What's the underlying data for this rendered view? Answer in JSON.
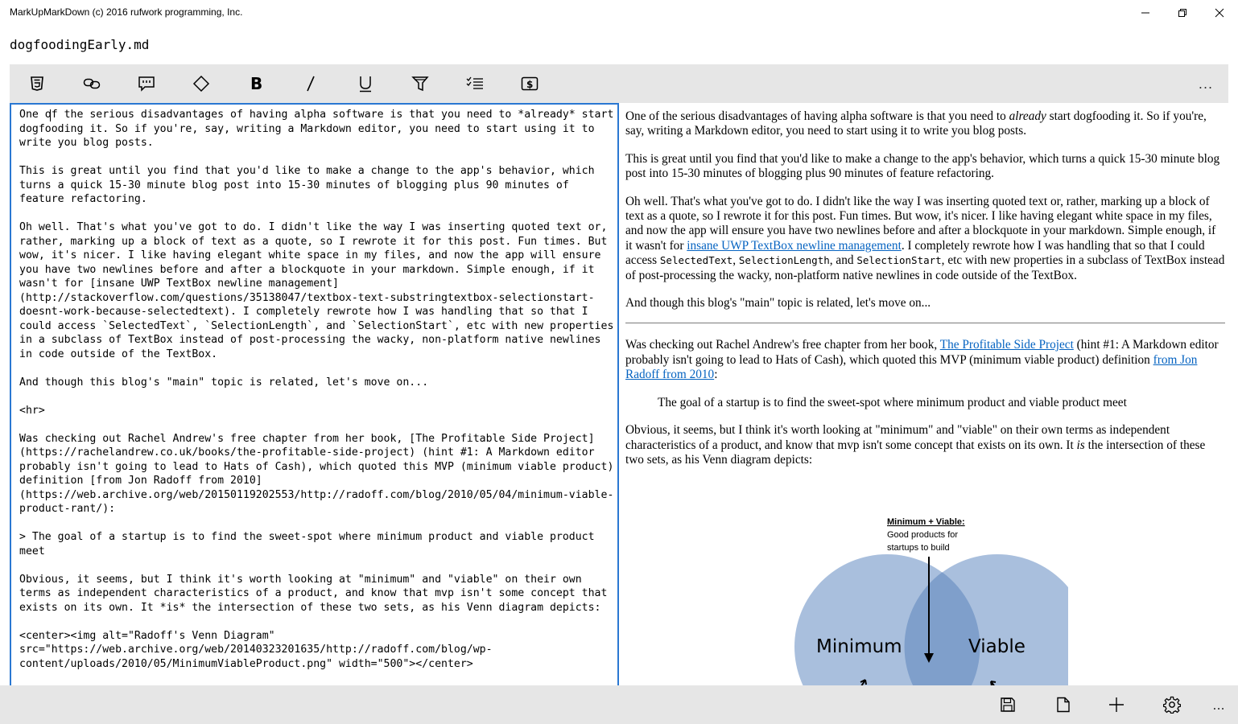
{
  "window": {
    "title": "MarkUpMarkDown (c) 2016 rufwork programming, Inc.",
    "controls": [
      "minimize-icon",
      "restore-icon",
      "close-icon"
    ]
  },
  "file": {
    "name": "dogfoodingEarly.md"
  },
  "toolbar": {
    "buttons": [
      "html5-icon",
      "link-icon",
      "comment-icon",
      "diamond-icon",
      "bold-icon",
      "italic-icon",
      "underline-icon",
      "highlight-icon",
      "checklist-icon",
      "dollar-icon"
    ],
    "more": "..."
  },
  "editor": {
    "text": "One of the serious disadvantages of having alpha software is that you need to *already* start dogfooding it. So if you're, say, writing a Markdown editor, you need to start using it to write you blog posts.\n\nThis is great until you find that you'd like to make a change to the app's behavior, which turns a quick 15-30 minute blog post into 15-30 minutes of blogging plus 90 minutes of feature refactoring.\n\nOh well. That's what you've got to do. I didn't like the way I was inserting quoted text or, rather, marking up a block of text as a quote, so I rewrote it for this post. Fun times. But wow, it's nicer. I like having elegant white space in my files, and now the app will ensure you have two newlines before and after a blockquote in your markdown. Simple enough, if it wasn't for [insane UWP TextBox newline management](http://stackoverflow.com/questions/35138047/textbox-text-substringtextbox-selectionstart-doesnt-work-because-selectedtext). I completely rewrote how I was handling that so that I could access `SelectedText`, `SelectionLength`, and `SelectionStart`, etc with new properties in a subclass of TextBox instead of post-processing the wacky, non-platform native newlines in code outside of the TextBox.\n\nAnd though this blog's \"main\" topic is related, let's move on...\n\n<hr>\n\nWas checking out Rachel Andrew's free chapter from her book, [The Profitable Side Project](https://rachelandrew.co.uk/books/the-profitable-side-project) (hint #1: A Markdown editor probably isn't going to lead to Hats of Cash), which quoted this MVP (minimum viable product) definition [from Jon Radoff from 2010](https://web.archive.org/web/20150119202553/http://radoff.com/blog/2010/05/04/minimum-viable-product-rant/):\n\n> The goal of a startup is to find the sweet-spot where minimum product and viable product meet\n\nObvious, it seems, but I think it's worth looking at \"minimum\" and \"viable\" on their own terms as independent characteristics of a product, and know that mvp isn't some concept that exists on its own. It *is* the intersection of these two sets, as his Venn diagram depicts:\n\n<center><img alt=\"Radoff's Venn Diagram\" src=\"https://web.archive.org/web/20140323201635/http://radoff.com/blog/wp-content/uploads/2010/05/MinimumViableProduct.png\" width=\"500\"></center>"
  },
  "preview": {
    "p1_a": "One of the serious disadvantages of having alpha software is that you need to ",
    "p1_em": "already",
    "p1_b": " start dogfooding it. So if you're, say, writing a Markdown editor, you need to start using it to write you blog posts.",
    "p2": "This is great until you find that you'd like to make a change to the app's behavior, which turns a quick 15-30 minute blog post into 15-30 minutes of blogging plus 90 minutes of feature refactoring.",
    "p3_a": "Oh well. That's what you've got to do. I didn't like the way I was inserting quoted text or, rather, marking up a block of text as a quote, so I rewrote it for this post. Fun times. But wow, it's nicer. I like having elegant white space in my files, and now the app will ensure you have two newlines before and after a blockquote in your markdown. Simple enough, if it wasn't for ",
    "p3_link": "insane UWP TextBox newline management",
    "p3_b": ". I completely rewrote how I was handling that so that I could access ",
    "p3_code1": "SelectedText",
    "p3_c": ", ",
    "p3_code2": "SelectionLength",
    "p3_d": ", and ",
    "p3_code3": "SelectionStart",
    "p3_e": ", etc with new properties in a subclass of TextBox instead of post-processing the wacky, non-platform native newlines in code outside of the TextBox.",
    "p4": "And though this blog's \"main\" topic is related, let's move on...",
    "p5_a": "Was checking out Rachel Andrew's free chapter from her book, ",
    "p5_link1": "The Profitable Side Project",
    "p5_b": " (hint #1: A Markdown editor probably isn't going to lead to Hats of Cash), which quoted this MVP (minimum viable product) definition ",
    "p5_link2": "from Jon Radoff from 2010",
    "p5_c": ":",
    "quote": "The goal of a startup is to find the sweet-spot where minimum product and viable product meet",
    "p6_a": "Obvious, it seems, but I think it's worth looking at \"minimum\" and \"viable\" on their own terms as independent characteristics of a product, and know that mvp isn't some concept that exists on its own. It ",
    "p6_em": "is",
    "p6_b": " the intersection of these two sets, as his Venn diagram depicts:",
    "venn": {
      "heading": "Minimum + Viable:",
      "line1": "Good products for",
      "line2": "startups to build",
      "left_label": "Minimum",
      "right_label": "Viable",
      "circle_color": "#a9bfdd",
      "overlap_color": "#7f9fcb"
    }
  },
  "bottombar": {
    "buttons": [
      "save-icon",
      "new-file-icon",
      "add-icon",
      "settings-icon"
    ],
    "more": "..."
  },
  "colors": {
    "accent": "#2a78d2",
    "toolbar_bg": "#e6e6e6",
    "link": "#0563c1"
  }
}
